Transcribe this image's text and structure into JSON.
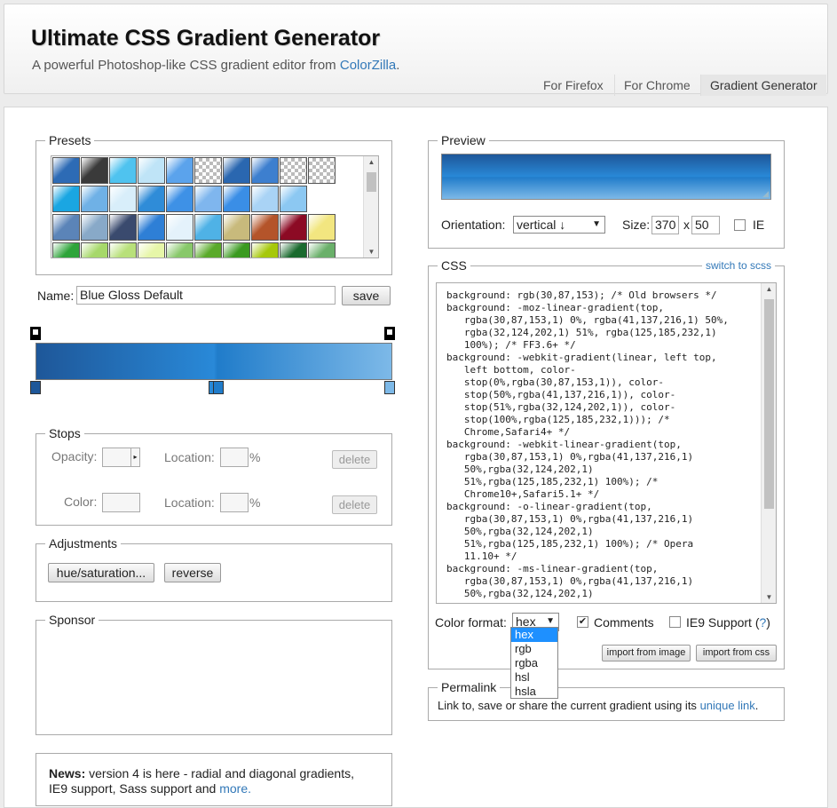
{
  "header": {
    "title": "Ultimate CSS Gradient Generator",
    "subtitle_prefix": "A powerful Photoshop-like CSS gradient editor from",
    "subtitle_link": "ColorZilla",
    "subtitle_suffix": ".",
    "nav": [
      "For Firefox",
      "For Chrome",
      "Gradient Generator"
    ]
  },
  "presets": {
    "legend": "Presets",
    "rows": [
      [
        "#2d6bb5",
        "#3a3a3a",
        "#4fc3ef",
        "#bfe4f7",
        "#5ba3ec",
        "checker",
        "#2a67b0",
        "#3d7fcf",
        "checker",
        "checker"
      ],
      [
        "#1aa6e2",
        "#6fb1e6",
        "#d8eefa",
        "#2f8cd8",
        "#3e91e6",
        "#7fb6ee",
        "#3a8ee6",
        "#a9d3f5",
        "#8cc8f2",
        ""
      ],
      [
        "#5b84b8",
        "#88a9c8",
        "#3a4a6e",
        "#2e7fd6",
        "#e4f2fb",
        "#4fb2e6",
        "#c8ba7c",
        "#b4542a",
        "#8c0a24",
        "#f2e680"
      ],
      [
        "#2ea43a",
        "#a6d86a",
        "#b8e07a",
        "#e6f6a8",
        "#88c86a",
        "#5aaa2a",
        "#3a9a20",
        "#a6c80a",
        "#1a6a2e",
        "#6ab06a"
      ]
    ]
  },
  "name_field": {
    "label": "Name:",
    "value": "Blue Gloss Default",
    "save": "save"
  },
  "stops": {
    "legend": "Stops",
    "opacity_label": "Opacity:",
    "location_label": "Location:",
    "percent": "%",
    "delete": "delete",
    "color_label": "Color:"
  },
  "adjustments": {
    "legend": "Adjustments",
    "hue": "hue/saturation...",
    "reverse": "reverse"
  },
  "sponsor": {
    "legend": "Sponsor"
  },
  "news": {
    "bold": "News:",
    "text": "version 4 is here - radial and diagonal gradients,",
    "text2": "IE9 support, Sass support and",
    "link": "more."
  },
  "preview": {
    "legend": "Preview",
    "orientation_label": "Orientation:",
    "orientation_value": "vertical ↓",
    "size_label": "Size:",
    "width": "370",
    "x": "x",
    "height": "50",
    "ie_label": "IE"
  },
  "css": {
    "legend": "CSS",
    "switch": "switch to scss",
    "code": "background: rgb(30,87,153); /* Old browsers */\nbackground: -moz-linear-gradient(top,\n   rgba(30,87,153,1) 0%, rgba(41,137,216,1) 50%,\n   rgba(32,124,202,1) 51%, rgba(125,185,232,1)\n   100%); /* FF3.6+ */\nbackground: -webkit-gradient(linear, left top,\n   left bottom, color-\n   stop(0%,rgba(30,87,153,1)), color-\n   stop(50%,rgba(41,137,216,1)), color-\n   stop(51%,rgba(32,124,202,1)), color-\n   stop(100%,rgba(125,185,232,1))); /*\n   Chrome,Safari4+ */\nbackground: -webkit-linear-gradient(top,\n   rgba(30,87,153,1) 0%,rgba(41,137,216,1)\n   50%,rgba(32,124,202,1)\n   51%,rgba(125,185,232,1) 100%); /*\n   Chrome10+,Safari5.1+ */\nbackground: -o-linear-gradient(top,\n   rgba(30,87,153,1) 0%,rgba(41,137,216,1)\n   50%,rgba(32,124,202,1)\n   51%,rgba(125,185,232,1) 100%); /* Opera\n   11.10+ */\nbackground: -ms-linear-gradient(top,\n   rgba(30,87,153,1) 0%,rgba(41,137,216,1)\n   50%,rgba(32,124,202,1)",
    "color_format_label": "Color format:",
    "color_format_value": "hex",
    "comments_label": "Comments",
    "ie9_label": "IE9 Support (",
    "ie9_help": "?",
    "ie9_close": ")",
    "import_image": "import from image",
    "import_css": "import from css",
    "format_options": [
      "hex",
      "rgb",
      "rgba",
      "hsl",
      "hsla"
    ]
  },
  "permalink": {
    "legend": "Permalink",
    "text": "Link to, save or share the current gradient using its",
    "link": "unique link",
    "suffix": "."
  }
}
